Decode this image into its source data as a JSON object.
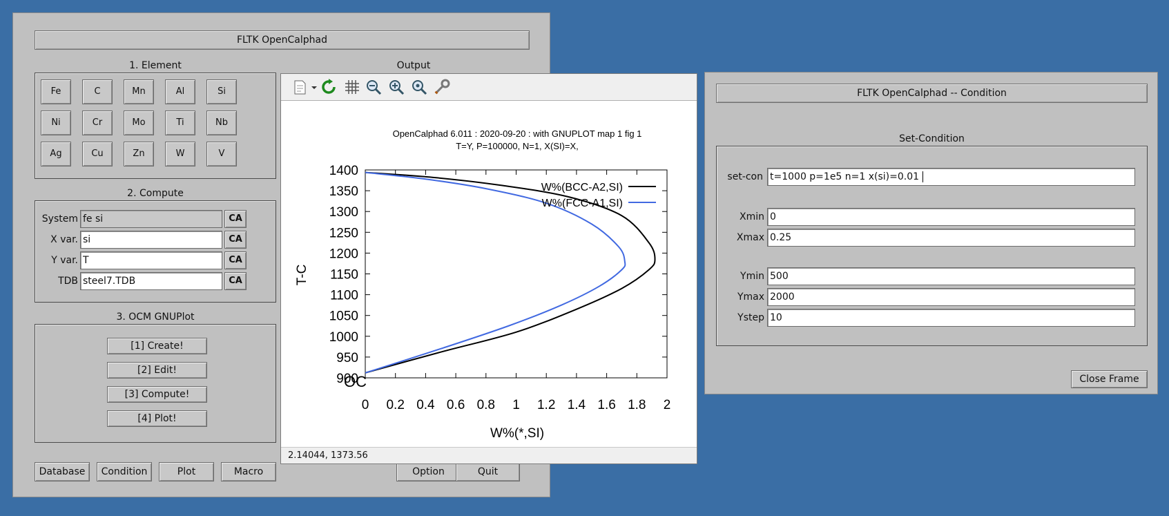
{
  "main_window": {
    "title": "FLTK OpenCalphad",
    "element_section": {
      "label": "1. Element",
      "elements": [
        "Fe",
        "C",
        "Mn",
        "Al",
        "Si",
        "Ni",
        "Cr",
        "Mo",
        "Ti",
        "Nb",
        "Ag",
        "Cu",
        "Zn",
        "W",
        "V"
      ]
    },
    "output_label": "Output",
    "compute_section": {
      "label": "2. Compute",
      "rows": [
        {
          "label": "System",
          "value": "fe si",
          "button": "CA"
        },
        {
          "label": "X var.",
          "value": "si",
          "button": "CA"
        },
        {
          "label": "Y var.",
          "value": "T",
          "button": "CA"
        },
        {
          "label": "TDB",
          "value": "steel7.TDB",
          "button": "CA"
        }
      ]
    },
    "gnuplot_section": {
      "label": "3. OCM GNUPlot",
      "buttons": [
        "[1] Create!",
        "[2] Edit!",
        "[3] Compute!",
        "[4] Plot!"
      ]
    },
    "bottom_buttons": [
      "Database",
      "Condition",
      "Plot",
      "Macro",
      "Option",
      "Quit"
    ]
  },
  "gnuplot_window": {
    "toolbar": [
      "export-icon",
      "dropdown-arrow-icon",
      "replot-icon",
      "grid-icon",
      "zoom-previous-icon",
      "zoom-next-icon",
      "autoscale-icon",
      "settings-icon"
    ],
    "status": "2.14044,  1373.56",
    "colors": {
      "bcc": "#000000",
      "fcc": "#4169e1"
    }
  },
  "chart_data": {
    "type": "line",
    "title": "OpenCalphad   6.011 :  2020-09-20 : with GNUPLOT map 1 fig 1",
    "subtitle": "T=Y,  P=100000, N=1, X(SI)=X,",
    "xlabel": "W%(*,SI)",
    "ylabel": "T-C",
    "x_origin_label": "OC",
    "xlim": [
      0,
      2
    ],
    "ylim": [
      900,
      1400
    ],
    "xticks": [
      0,
      0.2,
      0.4,
      0.6,
      0.8,
      1,
      1.2,
      1.4,
      1.6,
      1.8,
      2
    ],
    "yticks": [
      900,
      950,
      1000,
      1050,
      1100,
      1150,
      1200,
      1250,
      1300,
      1350,
      1400
    ],
    "legend_position": "top-right",
    "series": [
      {
        "name": "W%(BCC-A2,SI)",
        "color": "#000000",
        "points": [
          [
            0,
            912
          ],
          [
            0.5,
            962
          ],
          [
            1.0,
            1010
          ],
          [
            1.4,
            1065
          ],
          [
            1.7,
            1115
          ],
          [
            1.88,
            1160
          ],
          [
            1.92,
            1185
          ],
          [
            1.88,
            1225
          ],
          [
            1.7,
            1290
          ],
          [
            1.35,
            1335
          ],
          [
            0.9,
            1363
          ],
          [
            0.45,
            1382
          ],
          [
            0,
            1394
          ]
        ]
      },
      {
        "name": "W%(FCC-A1,SI)",
        "color": "#4169e1",
        "points": [
          [
            0,
            912
          ],
          [
            0.5,
            970
          ],
          [
            0.95,
            1025
          ],
          [
            1.3,
            1075
          ],
          [
            1.55,
            1120
          ],
          [
            1.7,
            1160
          ],
          [
            1.72,
            1180
          ],
          [
            1.68,
            1215
          ],
          [
            1.5,
            1270
          ],
          [
            1.2,
            1320
          ],
          [
            0.8,
            1355
          ],
          [
            0.4,
            1378
          ],
          [
            0,
            1394
          ]
        ]
      }
    ]
  },
  "condition_window": {
    "title": "FLTK OpenCalphad -- Condition",
    "section_label": "Set-Condition",
    "setcon": {
      "label": "set-con",
      "value": "t=1000 p=1e5 n=1  x(si)=0.01 "
    },
    "fields": [
      {
        "label": "Xmin",
        "value": "0"
      },
      {
        "label": "Xmax",
        "value": "0.25"
      },
      {
        "label": "Ymin",
        "value": "500"
      },
      {
        "label": "Ymax",
        "value": "2000"
      },
      {
        "label": "Ystep",
        "value": "10"
      }
    ],
    "close_button": "Close Frame"
  }
}
